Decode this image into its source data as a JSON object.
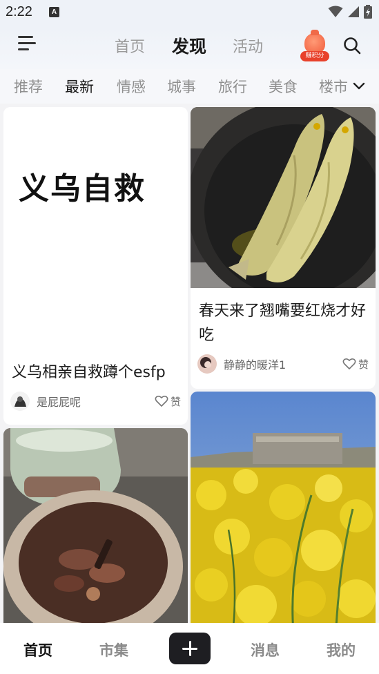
{
  "status_bar": {
    "time": "2:22",
    "notification_icon": "a-icon"
  },
  "header": {
    "menu_icon": "hamburger-menu-icon",
    "tabs": [
      {
        "label": "首页",
        "active": false
      },
      {
        "label": "发现",
        "active": true
      },
      {
        "label": "活动",
        "active": false
      }
    ],
    "points_badge": "赚积分",
    "search_icon": "search-icon"
  },
  "categories": [
    {
      "label": "推荐",
      "active": false
    },
    {
      "label": "最新",
      "active": true
    },
    {
      "label": "情感",
      "active": false
    },
    {
      "label": "城事",
      "active": false
    },
    {
      "label": "旅行",
      "active": false
    },
    {
      "label": "美食",
      "active": false
    },
    {
      "label": "楼市",
      "active": false
    }
  ],
  "feed": {
    "posts": [
      {
        "cover_text": "义乌自救",
        "title": "义乌相亲自救蹲个esfp",
        "author": "是屁屁呢",
        "like_label": "赞"
      },
      {
        "title": "春天来了翘嘴要红烧才好吃",
        "author": "静静的暖洋1",
        "like_label": "赞"
      },
      {
        "title": "",
        "author": "",
        "like_label": ""
      },
      {
        "title": "",
        "author": "",
        "like_label": ""
      }
    ]
  },
  "bottom_nav": [
    {
      "label": "首页",
      "active": true
    },
    {
      "label": "市集",
      "active": false
    },
    {
      "label": "消息",
      "active": false
    },
    {
      "label": "我的",
      "active": false
    }
  ],
  "colors": {
    "accent_badge": "#e8412b",
    "active_text": "#1a1a1a",
    "inactive_text": "#9a9a9a"
  }
}
